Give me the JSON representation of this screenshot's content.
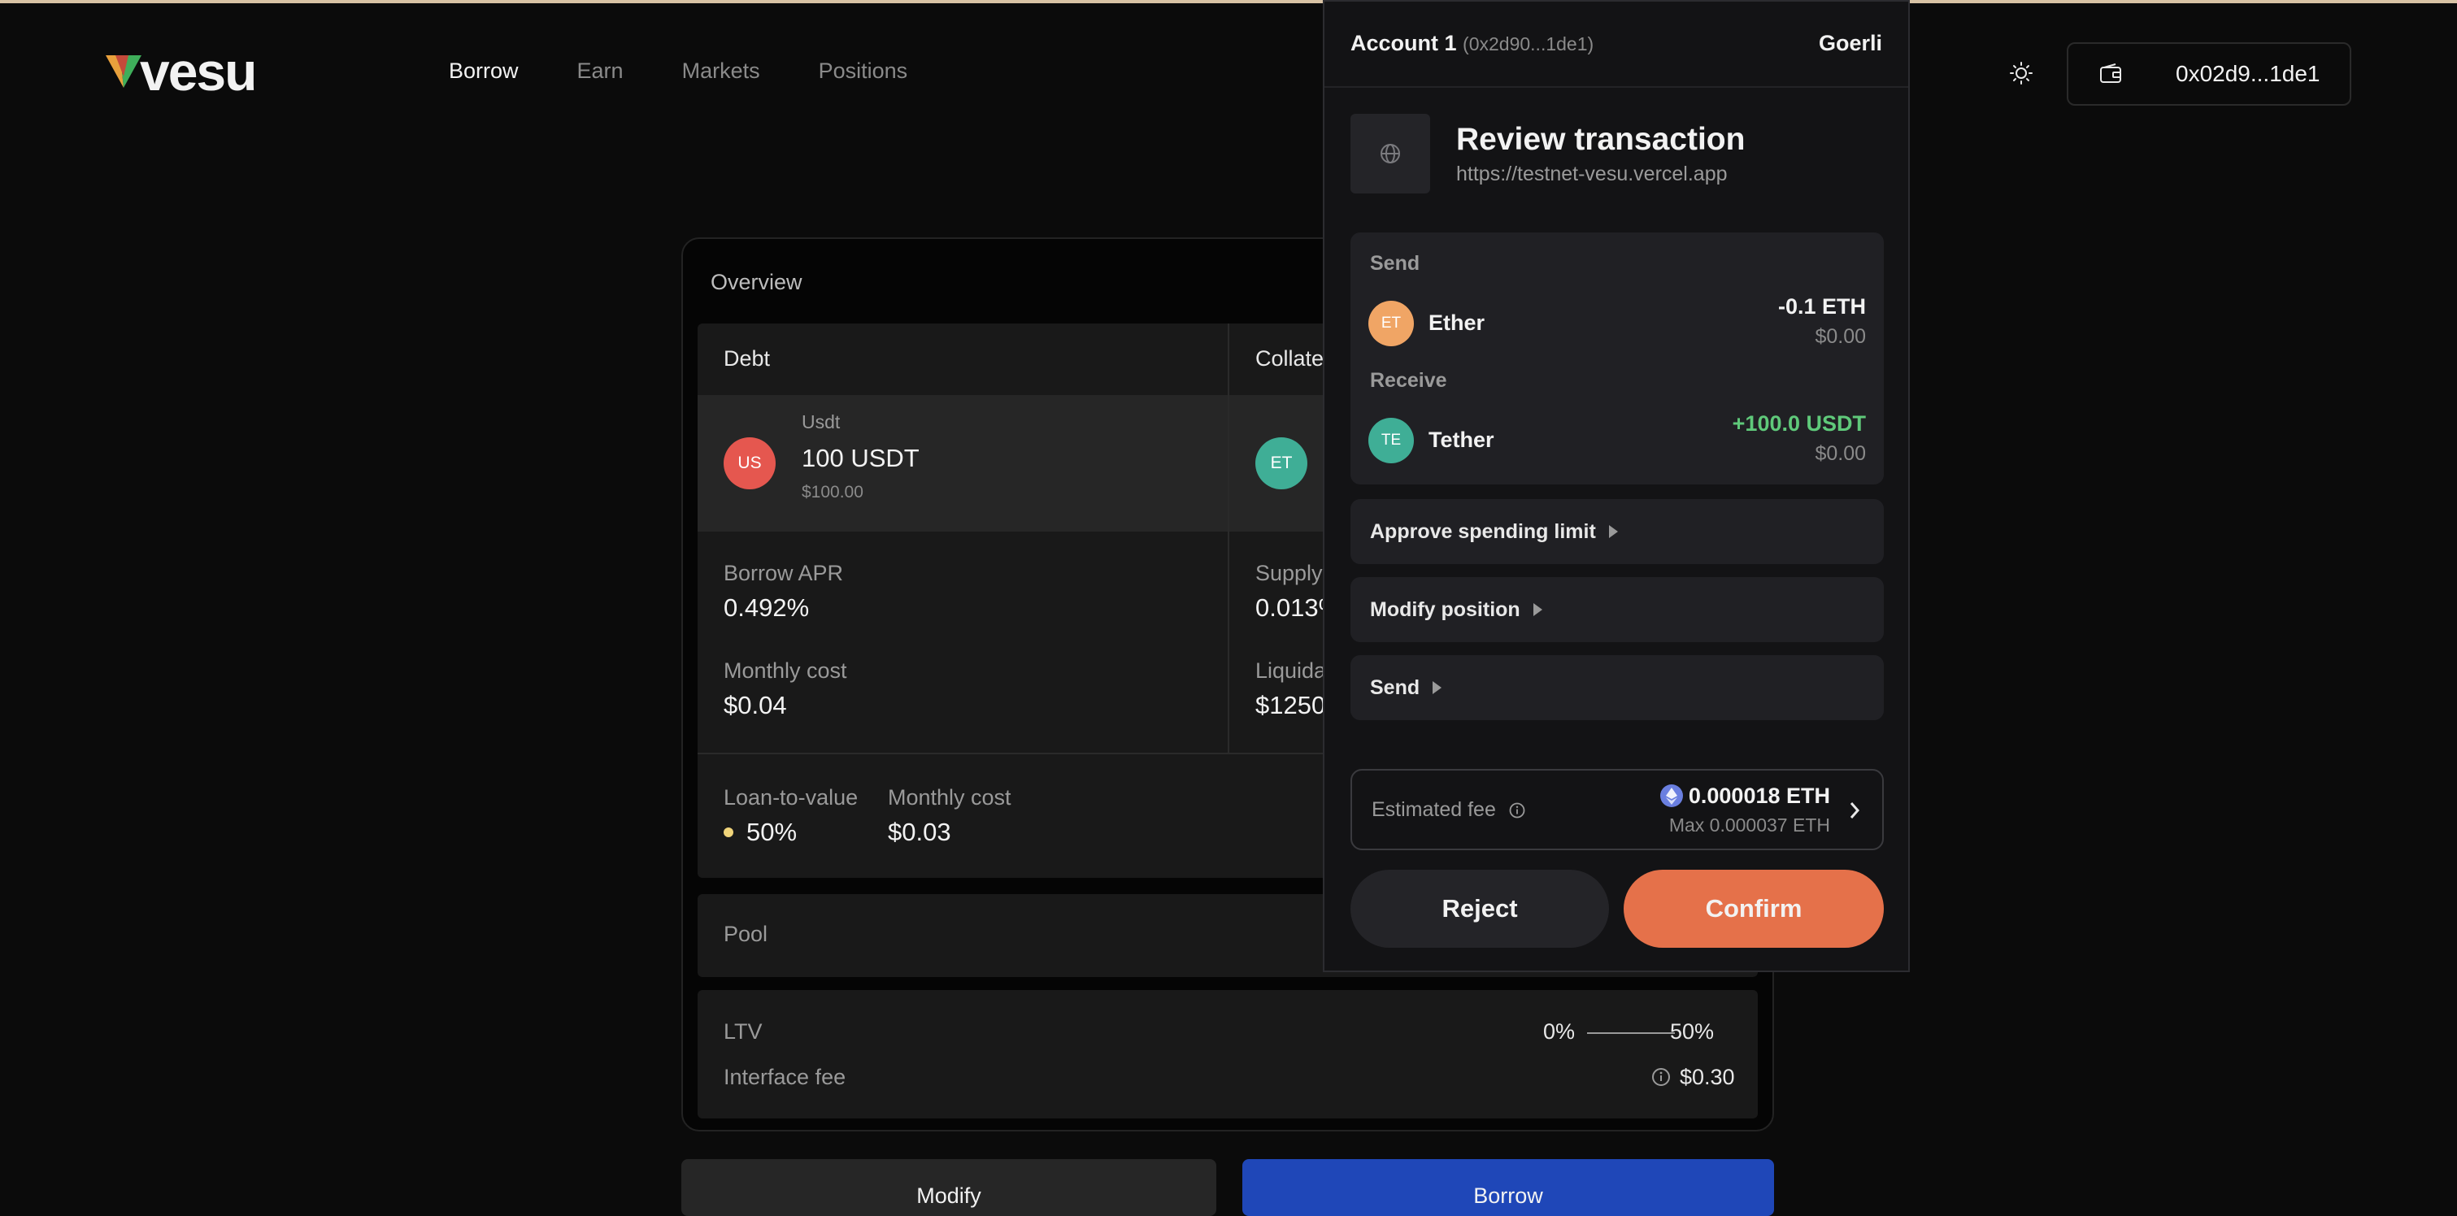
{
  "header": {
    "logo_text": "vesu",
    "nav": [
      "Borrow",
      "Earn",
      "Markets",
      "Positions"
    ],
    "wallet_address": "0x02d9...1de1"
  },
  "overview": {
    "title": "Overview",
    "debt": {
      "heading": "Debt",
      "token_initials": "US",
      "token_name": "Usdt",
      "amount": "100 USDT",
      "usd_value": "$100.00",
      "borrow_apr_label": "Borrow APR",
      "borrow_apr": "0.492%",
      "monthly_cost_label": "Monthly cost",
      "monthly_cost": "$0.04"
    },
    "collateral": {
      "heading": "Collate",
      "token_initials": "ET",
      "supply_label": "Supply",
      "supply_value": "0.013%",
      "liquidation_label": "Liquida",
      "liquidation_value": "$1250"
    },
    "summary": {
      "ltv_label": "Loan-to-value",
      "ltv_value": "50%",
      "monthly_cost_label": "Monthly cost",
      "monthly_cost": "$0.03"
    },
    "pool_label": "Pool",
    "ltv_row": {
      "label": "LTV",
      "from": "0%",
      "to": "50%"
    },
    "fee_row": {
      "label": "Interface fee",
      "value": "$0.30"
    }
  },
  "actions": {
    "modify": "Modify",
    "borrow": "Borrow"
  },
  "popup": {
    "account_name": "Account 1",
    "account_short": "(0x2d90...1de1)",
    "network": "Goerli",
    "title": "Review transaction",
    "url": "https://testnet-vesu.vercel.app",
    "send_label": "Send",
    "send": {
      "initials": "ET",
      "name": "Ether",
      "amount": "-0.1 ETH",
      "usd": "$0.00"
    },
    "receive_label": "Receive",
    "receive": {
      "initials": "TE",
      "name": "Tether",
      "amount": "+100.0 USDT",
      "usd": "$0.00"
    },
    "sections": [
      "Approve spending limit",
      "Modify position",
      "Send"
    ],
    "fee_label": "Estimated fee",
    "fee_value": "0.000018 ETH",
    "fee_max": "Max 0.000037 ETH",
    "reject": "Reject",
    "confirm": "Confirm"
  },
  "colors": {
    "accent_orange": "#e5714a",
    "borrow_blue": "#1f47b8",
    "positive_green": "#5fc97a",
    "usdt_red": "#e5574f",
    "eth_teal": "#3fae96"
  }
}
